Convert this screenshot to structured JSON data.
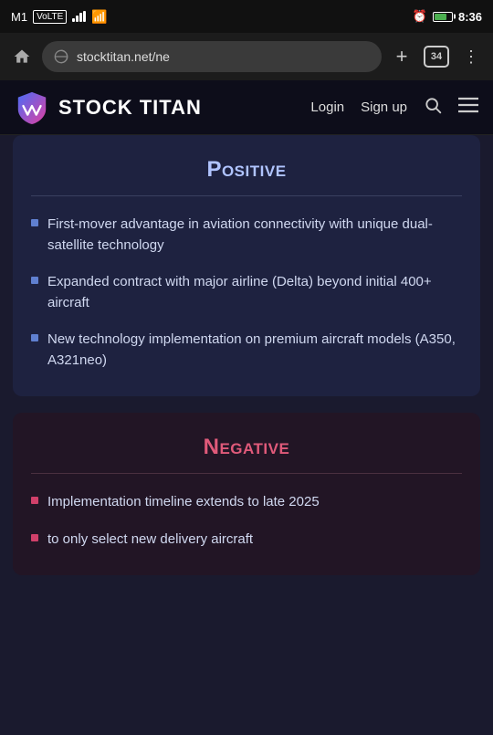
{
  "statusBar": {
    "carrier": "M1",
    "carrierType": "VoLTE",
    "time": "8:36",
    "battery": "5B",
    "alarmIcon": true
  },
  "browserBar": {
    "url": "stocktitan.net/ne",
    "tabCount": "34"
  },
  "siteHeader": {
    "title": "STOCK TITAN",
    "loginLabel": "Login",
    "signupLabel": "Sign up"
  },
  "positive": {
    "title": "Positive",
    "bullets": [
      "First-mover advantage in aviation connectivity with unique dual-satellite technology",
      "Expanded contract with major airline (Delta) beyond initial 400+ aircraft",
      "New technology implementation on premium aircraft models (A350, A321neo)"
    ]
  },
  "negative": {
    "title": "Negative",
    "bullets": [
      "Implementation timeline extends to late 2025",
      "to only select new delivery aircraft"
    ]
  }
}
